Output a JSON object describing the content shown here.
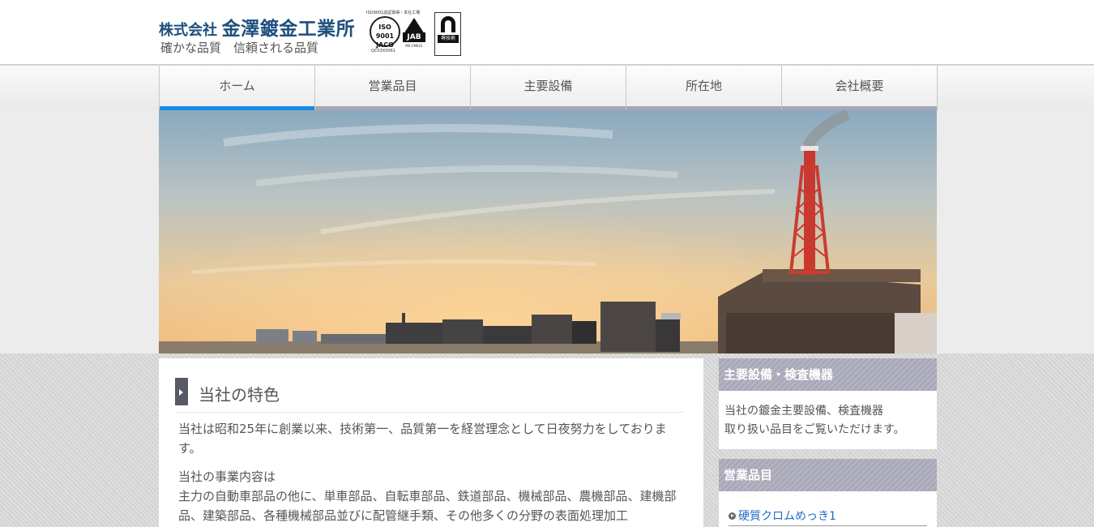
{
  "header": {
    "company_prefix": "株式会社",
    "company_name": "金澤鍍金工業所",
    "tagline": "確かな品質　信頼される品質",
    "cert_iso_caption": "ISO9001認証取得・本社工場",
    "cert_iso_mark": "ISO 9001 JACO",
    "cert_iso_code": "QC03X0061",
    "cert_jab_label": "JAB",
    "cert_jab_sub": "MS CM021",
    "cert_third_label": "堺技術"
  },
  "nav": {
    "items": [
      {
        "label": "ホーム",
        "active": true
      },
      {
        "label": "営業品目",
        "active": false
      },
      {
        "label": "主要設備",
        "active": false
      },
      {
        "label": "所在地",
        "active": false
      },
      {
        "label": "会社概要",
        "active": false
      }
    ]
  },
  "main": {
    "section_title": "当社の特色",
    "paragraph1": "当社は昭和25年に創業以来、技術第一、品質第一を経営理念として日夜努力をしております。",
    "paragraph2_line1": "当社の事業内容は",
    "paragraph2_line2": "主力の自動車部品の他に、単車部品、自転車部品、鉄道部品、機械部品、農機部品、建機部品、建築部品、各種機械部品並びに配管継手類、その他多くの分野の表面処理加工"
  },
  "sidebar": {
    "box1": {
      "title": "主要設備・検査機器",
      "line1": "当社の鍍金主要設備、検査機器",
      "line2": "取り扱い品目をご覧いただけます。"
    },
    "box2": {
      "title": "営業品目",
      "link1": "硬質クロムめっき1"
    }
  },
  "colors": {
    "nav_active": "#1e88e5",
    "nav_inactive_bar": "#a6a6b5",
    "brand_blue": "#1d4f7e",
    "link_blue": "#1e6fc9",
    "sidebar_head": "#a8a8b8"
  }
}
